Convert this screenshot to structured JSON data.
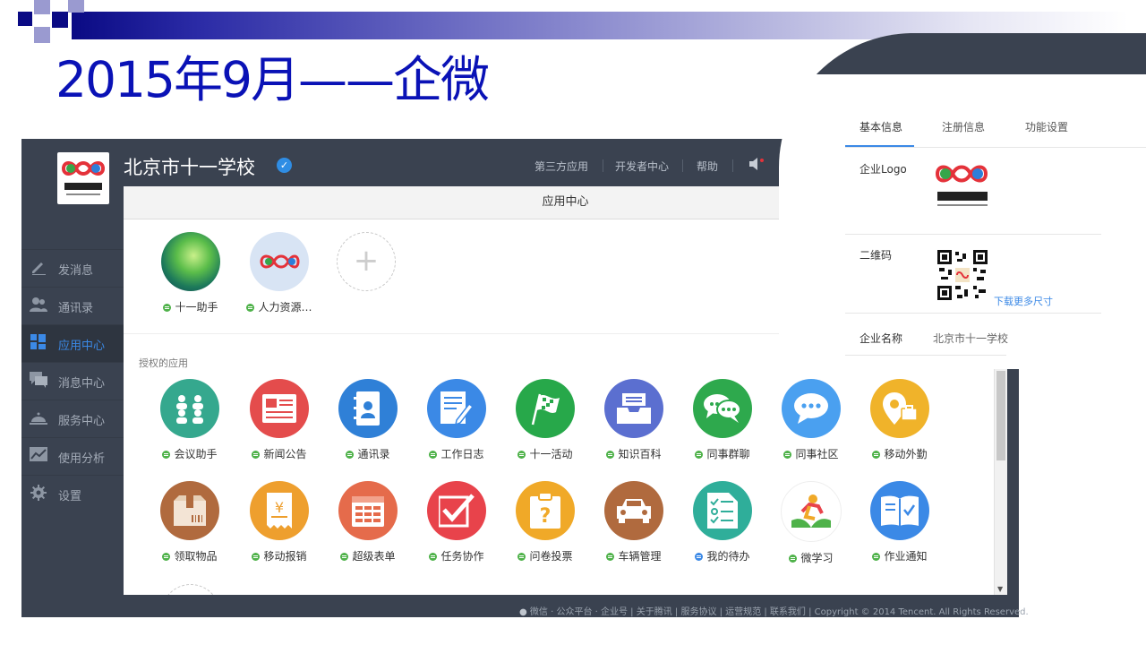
{
  "slide": {
    "title": "2015年9月——企微"
  },
  "header": {
    "org_name": "北京市十一学校",
    "verified_mark": "✓",
    "nav": [
      "第三方应用",
      "开发者中心",
      "帮助"
    ],
    "speaker_icon": "speaker-icon"
  },
  "sidebar": {
    "items": [
      {
        "label": "发消息",
        "icon": "pencil-icon"
      },
      {
        "label": "通讯录",
        "icon": "contacts-icon"
      },
      {
        "label": "应用中心",
        "icon": "apps-icon",
        "active": true
      },
      {
        "label": "消息中心",
        "icon": "messages-icon"
      },
      {
        "label": "服务中心",
        "icon": "service-bell-icon"
      },
      {
        "label": "使用分析",
        "icon": "chart-icon"
      },
      {
        "label": "设置",
        "icon": "gear-icon"
      }
    ]
  },
  "panel": {
    "title": "应用中心",
    "my_apps": [
      {
        "label": "十一助手",
        "icon": "landscape-icon"
      },
      {
        "label": "人力资源…",
        "icon": "school-logo-icon"
      }
    ],
    "add_symbol": "+",
    "authorized_label": "授权的应用",
    "apps_row1": [
      {
        "label": "会议助手",
        "icon": "meeting-icon",
        "color": "#35a88e"
      },
      {
        "label": "新闻公告",
        "icon": "news-icon",
        "color": "#e44c4c"
      },
      {
        "label": "通讯录",
        "icon": "address-book-icon",
        "color": "#2f80d7"
      },
      {
        "label": "工作日志",
        "icon": "worklog-icon",
        "color": "#3b89e6"
      },
      {
        "label": "十一活动",
        "icon": "flag-icon",
        "color": "#27a84a"
      },
      {
        "label": "知识百科",
        "icon": "archive-icon",
        "color": "#5b6fd0"
      },
      {
        "label": "同事群聊",
        "icon": "group-chat-icon",
        "color": "#2ea94d"
      },
      {
        "label": "同事社区",
        "icon": "chat-bubble-icon",
        "color": "#4aa0f0"
      },
      {
        "label": "移动外勤",
        "icon": "location-icon",
        "color": "#f0b32a"
      }
    ],
    "apps_row2": [
      {
        "label": "领取物品",
        "icon": "package-icon",
        "color": "#b06a3e"
      },
      {
        "label": "移动报销",
        "icon": "receipt-icon",
        "color": "#ee9f2e"
      },
      {
        "label": "超级表单",
        "icon": "form-icon",
        "color": "#e56b4b"
      },
      {
        "label": "任务协作",
        "icon": "task-check-icon",
        "color": "#e8434b"
      },
      {
        "label": "问卷投票",
        "icon": "survey-icon",
        "color": "#f0a928"
      },
      {
        "label": "车辆管理",
        "icon": "car-icon",
        "color": "#b06a3e"
      },
      {
        "label": "我的待办",
        "icon": "todo-icon",
        "color": "#2fae9a",
        "dot": "home"
      },
      {
        "label": "微学习",
        "icon": "learn-icon",
        "color": "#ffffff"
      },
      {
        "label": "作业通知",
        "icon": "book-icon",
        "color": "#3b89e6"
      }
    ]
  },
  "footer": {
    "text": "微信 · 公众平台 · 企业号 | 关于腾讯 | 服务协议 | 运营规范 | 联系我们 | Copyright © 2014 Tencent. All Rights Reserved."
  },
  "overlay": {
    "tabs": [
      "基本信息",
      "注册信息",
      "功能设置"
    ],
    "rows": {
      "logo_label": "企业Logo",
      "qr_label": "二维码",
      "qr_link": "下载更多尺寸",
      "name_label": "企业名称",
      "name_value": "北京市十一学校"
    }
  }
}
